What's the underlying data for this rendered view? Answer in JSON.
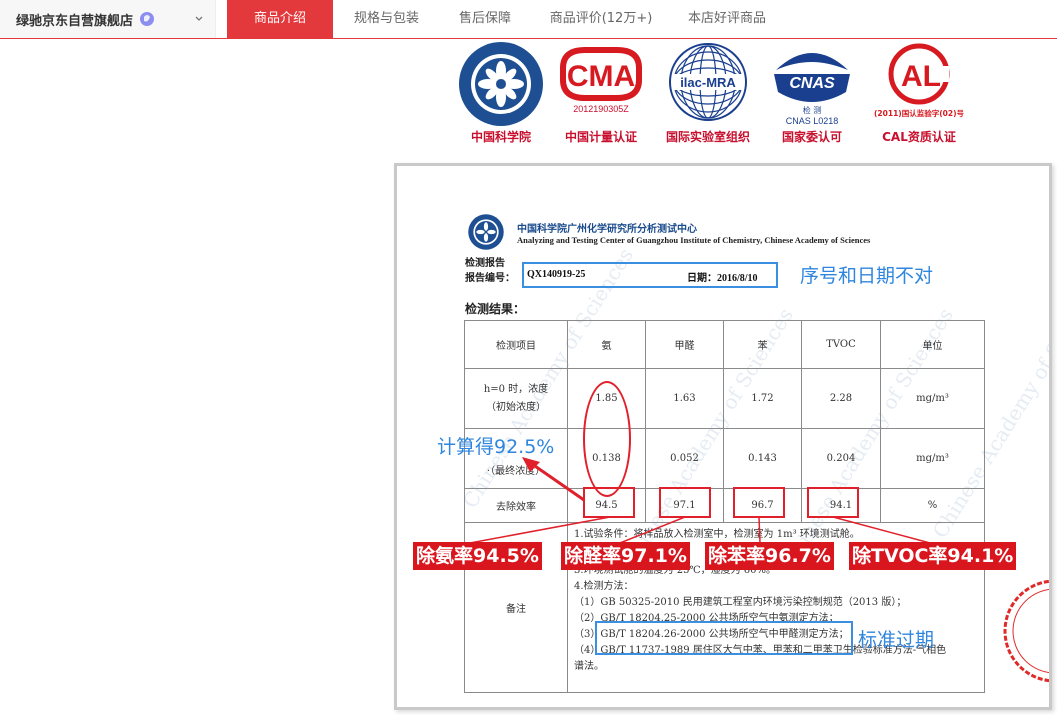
{
  "shop": {
    "name": "绿驰京东自营旗舰店",
    "badge_icon": "verified-badge-icon",
    "chevron_icon": "chevron-down-icon"
  },
  "tabs": [
    {
      "label": "商品介绍",
      "active": true
    },
    {
      "label": "规格与包装",
      "active": false
    },
    {
      "label": "售后保障",
      "active": false
    },
    {
      "label": "商品评价(12万+)",
      "active": false
    },
    {
      "label": "本店好评商品",
      "active": false
    }
  ],
  "certs": [
    {
      "label": "中国科学院",
      "icon": "cas-seal-icon"
    },
    {
      "label": "中国计量认证",
      "icon": "cma-logo-icon",
      "logo_text": "CMA",
      "sub": "2012190305Z"
    },
    {
      "label": "国际实验室组织",
      "icon": "ilac-mra-logo-icon",
      "logo_text": "ilac-MRA"
    },
    {
      "label": "国家委认可",
      "icon": "cnas-logo-icon",
      "logo_text": "CNAS",
      "sub1": "检 测",
      "sub2": "CNAS L0218"
    },
    {
      "label": "CAL资质认证",
      "icon": "cal-logo-icon",
      "logo_text": "AL",
      "sub": "(2011)国认监验字(02)号"
    }
  ],
  "report": {
    "org_cn": "中国科学院广州化学研究所分析测试中心",
    "org_en": "Analyzing and Testing Center of Guangzhou Institute of Chemistry, Chinese Academy of Sciences",
    "title": "检测报告",
    "number_label": "报告编号：",
    "number": "QX140919-25",
    "date": "日期：2016/8/10",
    "results_label": "检测结果：",
    "columns": [
      "检测项目",
      "氨",
      "甲醛",
      "苯",
      "TVOC",
      "单位"
    ],
    "row1_label_a": "h=0 时，浓度",
    "row1_label_b": "（初始浓度）",
    "row1": [
      "1.85",
      "1.63",
      "1.72",
      "2.28"
    ],
    "row1_unit": "mg/m³",
    "row2_label": "·（最终浓度）",
    "row2": [
      "0.138",
      "0.052",
      "0.143",
      "0.204"
    ],
    "row2_unit": "mg/m³",
    "row3_label": "去除效率",
    "row3": [
      "94.5",
      "97.1",
      "96.7",
      "94.1"
    ],
    "row3_unit": "%",
    "notes_label": "备注",
    "notes": [
      "1.试验条件：将样品放入检测室中，检测室为 1m³ 环境测试舱。",
      "3.环境测试舱的温度为 25℃，湿度为 60%。",
      "4.检测方法：",
      "（1）GB 50325-2010 民用建筑工程室内环境污染控制规范（2013 版）；",
      "（2）GB/T 18204.25-2000 公共场所空气中氨测定方法；",
      "（3）GB/T 18204.26-2000 公共场所空气中甲醛测定方法；",
      "（4）GB/T 11737-1989 居住区大气中苯、甲苯和二甲苯卫生检验标准方法-气相色",
      "谱法。"
    ]
  },
  "annotations": {
    "serial_wrong": "序号和日期不对",
    "calc": "计算得92.5%",
    "standard_expired": "标准过期",
    "tags": [
      "除氨率94.5%",
      "除醛率97.1%",
      "除苯率96.7%",
      "除TVOC率94.1%"
    ]
  },
  "colors": {
    "brand_red": "#e4393c",
    "annotation_blue": "#2f86de",
    "annotation_red": "#e0202a"
  }
}
